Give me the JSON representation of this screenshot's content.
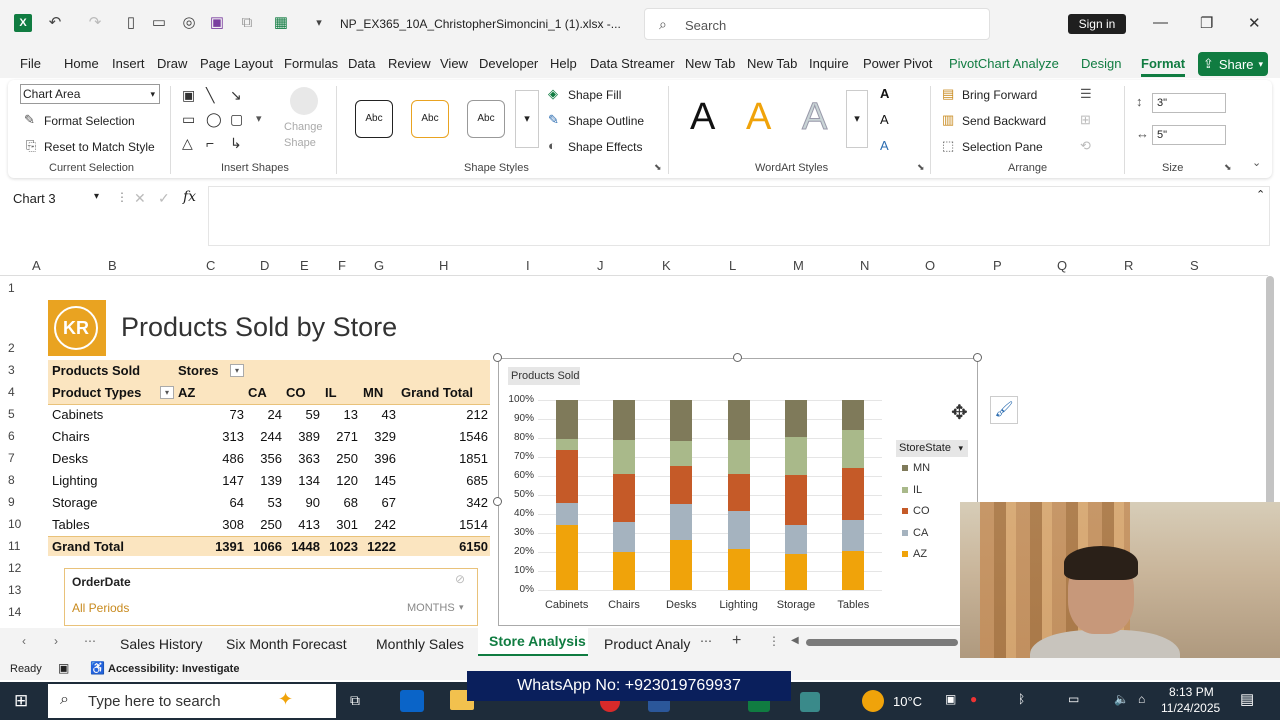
{
  "window": {
    "filename": "NP_EX365_10A_ChristopherSimoncini_1 (1).xlsx  -...",
    "search_placeholder": "Search",
    "signin": "Sign in"
  },
  "menu": {
    "tabs": [
      "File",
      "Home",
      "Insert",
      "Draw",
      "Page Layout",
      "Formulas",
      "Data",
      "Review",
      "View",
      "Developer",
      "Help",
      "Data Streamer",
      "New Tab",
      "New Tab",
      "Inquire",
      "Power Pivot"
    ],
    "context_tabs": [
      "PivotChart Analyze",
      "Design",
      "Format"
    ],
    "active": "Format",
    "share": "Share"
  },
  "ribbon": {
    "current_selection": {
      "dropdown_value": "Chart Area",
      "format_selection": "Format Selection",
      "reset": "Reset to Match Style",
      "label": "Current Selection"
    },
    "insert_shapes": {
      "change_shape_1": "Change",
      "change_shape_2": "Shape",
      "label": "Insert Shapes"
    },
    "shape_styles": {
      "styles": [
        "Abc",
        "Abc",
        "Abc"
      ],
      "fill": "Shape Fill",
      "outline": "Shape Outline",
      "effects": "Shape Effects",
      "label": "Shape Styles"
    },
    "wordart": {
      "letters": [
        "A",
        "A",
        "A"
      ],
      "label": "WordArt Styles"
    },
    "arrange": {
      "bring_forward": "Bring Forward",
      "send_backward": "Send Backward",
      "selection_pane": "Selection Pane",
      "label": "Arrange"
    },
    "size": {
      "height": "3\"",
      "width": "5\"",
      "label": "Size"
    }
  },
  "formula_bar": {
    "name_box": "Chart 3",
    "fx": "fx"
  },
  "columns": [
    "A",
    "B",
    "C",
    "D",
    "E",
    "F",
    "G",
    "H",
    "I",
    "J",
    "K",
    "L",
    "M",
    "N",
    "O",
    "P",
    "Q",
    "R",
    "S"
  ],
  "rows": [
    "1",
    "2",
    "3",
    "4",
    "5",
    "6",
    "7",
    "8",
    "9",
    "10",
    "11",
    "12",
    "13",
    "14"
  ],
  "sheet": {
    "logo_text": "KR",
    "title": "Products Sold by Store"
  },
  "pivot": {
    "values_label": "Products Sold",
    "columns_label": "Stores",
    "rows_label": "Product Types",
    "headers": [
      "AZ",
      "CA",
      "CO",
      "IL",
      "MN",
      "Grand Total"
    ],
    "rows": [
      {
        "name": "Cabinets",
        "values": [
          "73",
          "24",
          "59",
          "13",
          "43",
          "212"
        ]
      },
      {
        "name": "Chairs",
        "values": [
          "313",
          "244",
          "389",
          "271",
          "329",
          "1546"
        ]
      },
      {
        "name": "Desks",
        "values": [
          "486",
          "356",
          "363",
          "250",
          "396",
          "1851"
        ]
      },
      {
        "name": "Lighting",
        "values": [
          "147",
          "139",
          "134",
          "120",
          "145",
          "685"
        ]
      },
      {
        "name": "Storage",
        "values": [
          "64",
          "53",
          "90",
          "68",
          "67",
          "342"
        ]
      },
      {
        "name": "Tables",
        "values": [
          "308",
          "250",
          "413",
          "301",
          "242",
          "1514"
        ]
      }
    ],
    "total": {
      "name": "Grand Total",
      "values": [
        "1391",
        "1066",
        "1448",
        "1023",
        "1222",
        "6150"
      ]
    }
  },
  "slicer": {
    "title": "OrderDate",
    "period": "All Periods",
    "unit": "MONTHS"
  },
  "chart_data": {
    "type": "bar",
    "stacked": "percent",
    "title_button": "Products Sold",
    "legend_title": "StoreState",
    "categories": [
      "Cabinets",
      "Chairs",
      "Desks",
      "Lighting",
      "Storage",
      "Tables"
    ],
    "series": [
      {
        "name": "AZ",
        "color": "#f0a30a",
        "values": [
          73,
          313,
          486,
          147,
          64,
          308
        ]
      },
      {
        "name": "CA",
        "color": "#a5b3bf",
        "values": [
          24,
          244,
          356,
          139,
          53,
          250
        ]
      },
      {
        "name": "CO",
        "color": "#c55a28",
        "values": [
          59,
          389,
          363,
          134,
          90,
          413
        ]
      },
      {
        "name": "IL",
        "color": "#a9b98a",
        "values": [
          13,
          271,
          250,
          120,
          68,
          301
        ]
      },
      {
        "name": "MN",
        "color": "#7f7a5a",
        "values": [
          43,
          329,
          396,
          145,
          67,
          242
        ]
      }
    ],
    "y_ticks": [
      "0%",
      "10%",
      "20%",
      "30%",
      "40%",
      "50%",
      "60%",
      "70%",
      "80%",
      "90%",
      "100%"
    ],
    "ylim": [
      0,
      100
    ]
  },
  "sheet_tabs": {
    "tabs": [
      "Sales History",
      "Six Month Forecast",
      "Monthly Sales",
      "Store Analysis",
      "Product Analy"
    ],
    "active": "Store Analysis"
  },
  "status": {
    "ready": "Ready",
    "accessibility": "Accessibility: Investigate"
  },
  "overlay": {
    "banner": "WhatsApp No: +923019769937"
  },
  "taskbar": {
    "search_placeholder": "Type here to search",
    "temperature": "10°C",
    "time": "8:13 PM",
    "date": "11/24/2025"
  }
}
